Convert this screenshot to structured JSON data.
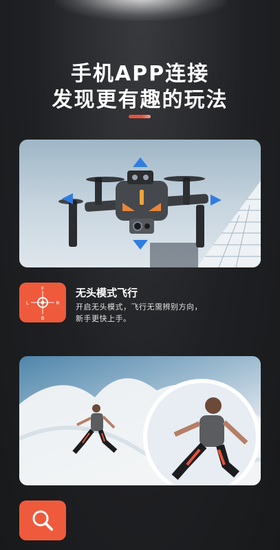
{
  "header": {
    "line1": "手机APP连接",
    "line2": "发现更有趣的玩法"
  },
  "feature_headless": {
    "title": "无头模式飞行",
    "desc_line1": "开启无头模式，飞行无需辨别方向，",
    "desc_line2": "新手更快上手。",
    "icon_letters": {
      "front": "F",
      "left": "L",
      "right": "R",
      "back": "B"
    }
  },
  "feature_search": {
    "icon": "search-icon"
  },
  "colors": {
    "accent": "#ef5a3c",
    "arrow_blue": "#2f7de1",
    "background": "#1f2023"
  },
  "icons": [
    "compass-icon",
    "search-icon",
    "arrow-up-icon",
    "arrow-down-icon",
    "arrow-left-icon",
    "arrow-right-icon"
  ]
}
